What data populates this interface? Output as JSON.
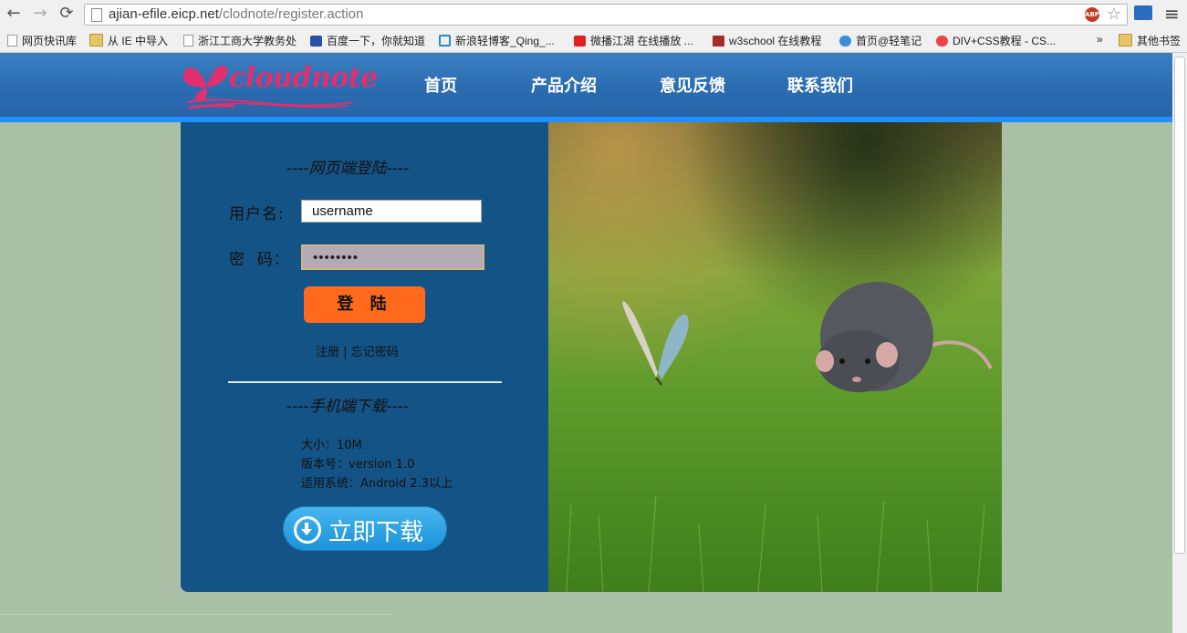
{
  "browser": {
    "url_host": "ajian-efile.eicp.net",
    "url_path": "/clodnote/register.action",
    "abp_label": "ABP",
    "bookmarks": [
      {
        "label": "网页快讯库",
        "icon": "page-icon"
      },
      {
        "label": "从 IE 中导入",
        "icon": "folder-icon"
      },
      {
        "label": "浙江工商大学教务处",
        "icon": "page-icon"
      },
      {
        "label": "百度一下，你就知道",
        "icon": "baidu-paw-icon"
      },
      {
        "label": "新浪轻博客_Qing_...",
        "icon": "qing-icon"
      },
      {
        "label": "微播江湖 在线播放 ...",
        "icon": "56-icon"
      },
      {
        "label": "w3school 在线教程",
        "icon": "w3school-icon"
      },
      {
        "label": "首页@轻笔记",
        "icon": "cloud-icon"
      },
      {
        "label": "DIV+CSS教程 - CS...",
        "icon": "css-icon"
      }
    ],
    "bookmarks_overflow": "»",
    "other_bookmarks": "其他书签"
  },
  "site": {
    "logo_text": "cloudnote",
    "nav": [
      "首页",
      "产品介绍",
      "意见反馈",
      "联系我们"
    ],
    "colors": {
      "header": "#2a6bb0",
      "panel": "#145385",
      "accent": "#ff6a1c",
      "background": "#a9bfa6"
    }
  },
  "login": {
    "title": "----网页端登陆----",
    "username_label": "用户名:",
    "username_value": "username",
    "password_label": "密  码：",
    "password_value": "••••••••",
    "login_button": "登 陆",
    "register_link": "注册",
    "separator": "|",
    "forgot_link": "忘记密码"
  },
  "mobile": {
    "title": "----手机端下载----",
    "size": "大小：10M",
    "version": "版本号：version 1.0",
    "system": "适用系统：Android 2.3以上",
    "download_button": "立即下载"
  }
}
